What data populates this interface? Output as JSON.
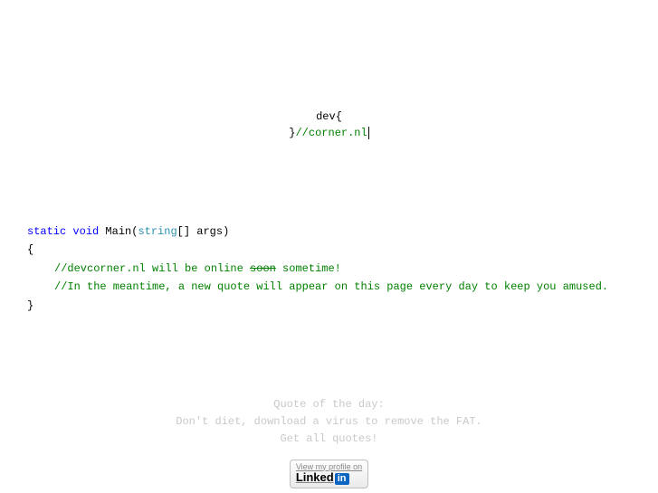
{
  "logo": {
    "line1": "dev{",
    "line2_brace": "}",
    "line2_comment": "//corner.nl"
  },
  "signature": {
    "static": "static",
    "void": "void",
    "main": " Main(",
    "string": "string",
    "rest": "[] args)"
  },
  "comments": {
    "line1_pre": "//devcorner.nl will be online ",
    "line1_strike": "soon",
    "line1_post": " sometime!",
    "line2": "//In the meantime, a new quote will appear on this page every day to keep you amused."
  },
  "braces": {
    "open": "{",
    "close": "}"
  },
  "qod": {
    "heading": "Quote of the day:",
    "quote": "Don't diet, download a virus to remove the FAT.",
    "link": "Get all quotes!"
  },
  "linkedin": {
    "prompt": "View my profile on",
    "word": "Linked",
    "in": "in"
  }
}
